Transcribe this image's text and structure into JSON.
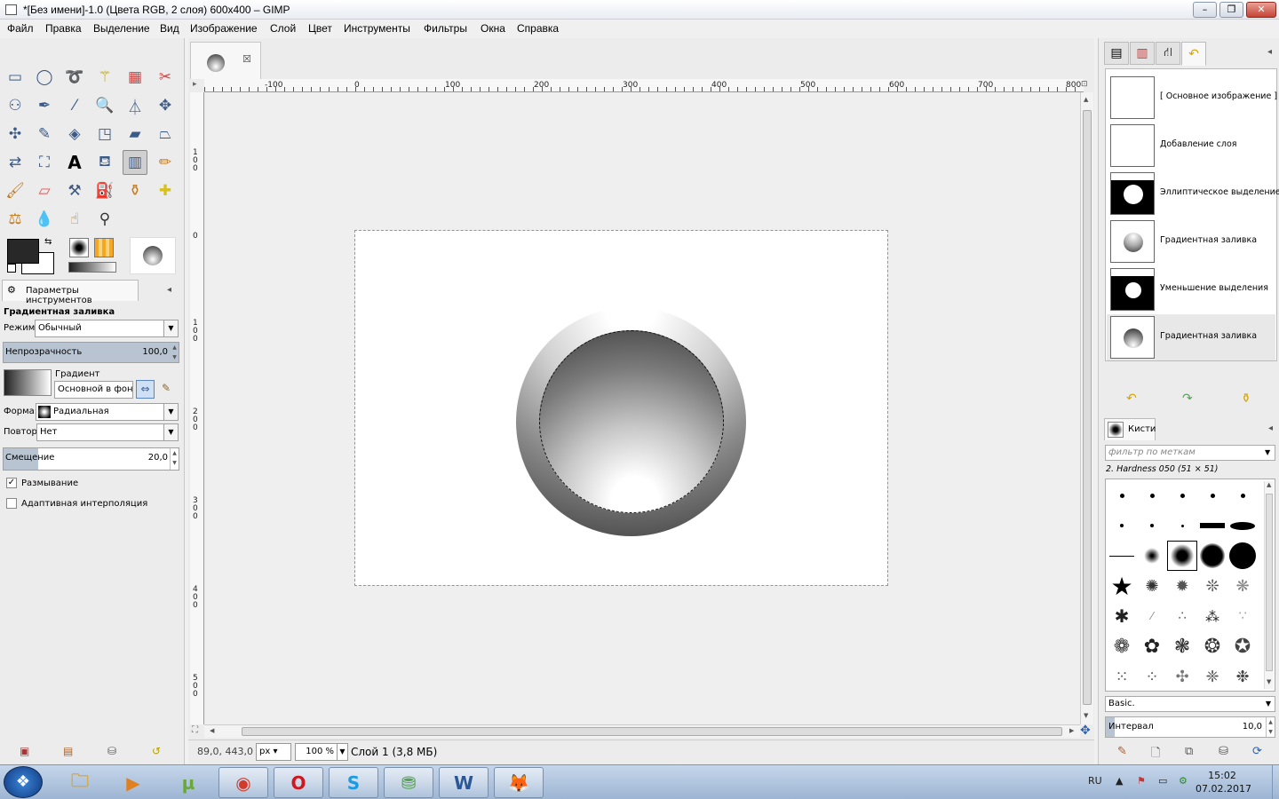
{
  "window": {
    "title": "*[Без имени]-1.0 (Цвета RGB, 2 слоя) 600x400 – GIMP",
    "min_glyph": "–",
    "max_glyph": "❐",
    "close_glyph": "✕"
  },
  "menu": [
    "Файл",
    "Правка",
    "Выделение",
    "Вид",
    "Изображение",
    "Слой",
    "Цвет",
    "Инструменты",
    "Фильтры",
    "Окна",
    "Справка"
  ],
  "tool_options": {
    "tab_label": "Параметры инструментов",
    "tool_name": "Градиентная заливка",
    "mode_label": "Режим:",
    "mode_value": "Обычный",
    "opacity_label": "Непрозрачность",
    "opacity_value": "100,0",
    "gradient_label": "Градиент",
    "gradient_value": "Основной в фонс",
    "shape_label": "Форма:",
    "shape_value": "Радиальная",
    "repeat_label": "Повтор:",
    "repeat_value": "Нет",
    "offset_label": "Смещение",
    "offset_value": "20,0",
    "dither_label": "Размывание",
    "dither_checked": true,
    "adaptive_label": "Адаптивная интерполяция",
    "adaptive_checked": false
  },
  "ruler": {
    "top_labels": [
      "-100",
      "0",
      "100",
      "200",
      "300",
      "400",
      "500",
      "600",
      "700",
      "800"
    ],
    "left_labels": [
      "100",
      "0",
      "100",
      "200",
      "300",
      "400",
      "500"
    ]
  },
  "status": {
    "coords": "89,0, 443,0",
    "unit": "px",
    "zoom": "100 %",
    "layer_info": "Слой 1 (3,8 МБ)"
  },
  "history": [
    {
      "label": "[ Основное изображение ]",
      "thumb": "blank"
    },
    {
      "label": "Добавление слоя",
      "thumb": "blank"
    },
    {
      "label": "Эллиптическое выделение",
      "thumb": "mask-large"
    },
    {
      "label": "Градиентная заливка",
      "thumb": "sphere"
    },
    {
      "label": "Уменьшение выделения",
      "thumb": "mask-small"
    },
    {
      "label": "Градиентная заливка",
      "thumb": "ring",
      "selected": true
    }
  ],
  "brushes": {
    "tab_label": "Кисти",
    "filter_placeholder": "фильтр по меткам",
    "selected_name": "2. Hardness 050 (51 × 51)",
    "set_value": "Basic.",
    "interval_label": "Интервал",
    "interval_value": "10,0"
  },
  "taskbar": {
    "start_glyph": "❖",
    "apps": [
      {
        "name": "explorer",
        "glyph": "🗀",
        "color": "#d9a63a"
      },
      {
        "name": "media-player",
        "glyph": "▶",
        "color": "#e08020"
      },
      {
        "name": "utorrent",
        "glyph": "µ",
        "color": "#6aa83a"
      },
      {
        "name": "chrome",
        "glyph": "◉",
        "color": "#d23b2c"
      },
      {
        "name": "opera",
        "glyph": "O",
        "color": "#d0161f"
      },
      {
        "name": "skype",
        "glyph": "S",
        "color": "#1e9ae0"
      },
      {
        "name": "app-green",
        "glyph": "⛃",
        "color": "#5aa05a"
      },
      {
        "name": "word",
        "glyph": "W",
        "color": "#2b5797"
      },
      {
        "name": "gimp",
        "glyph": "🦊",
        "color": "#6b5a3c"
      }
    ],
    "lang": "RU",
    "time": "15:02",
    "date": "07.02.2017"
  },
  "colors": {
    "accent_selection": "#b8a000",
    "slider_fill": "#b8c4d1",
    "foreground": "#282828",
    "background": "#ffffff"
  }
}
